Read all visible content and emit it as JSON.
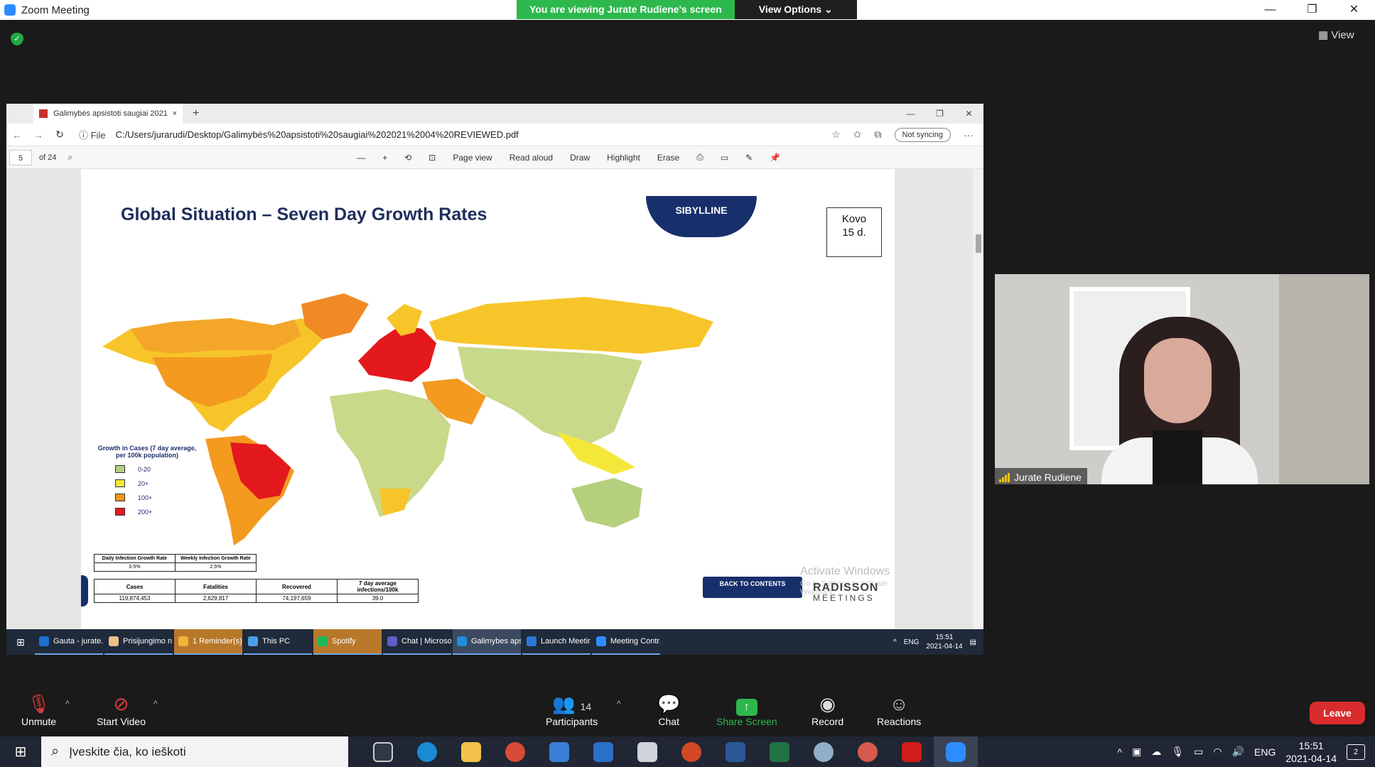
{
  "zoom": {
    "title": "Zoom Meeting",
    "viewing_banner": "You are viewing Jurate Rudiene's screen",
    "view_options": "View Options ⌄",
    "view_button": "View",
    "window_controls": [
      "—",
      "❐",
      "✕"
    ]
  },
  "edge": {
    "tab_title": "Galimybės apsistoti saugiai 2021",
    "tab_close": "×",
    "new_tab": "+",
    "file_label": "ⓘ  File",
    "url": "C:/Users/jurarudi/Desktop/Galimybės%20apsistoti%20saugiai%202021%2004%20REVIEWED.pdf",
    "sync_label": "Not syncing",
    "window_controls": [
      "—",
      "❐",
      "✕"
    ]
  },
  "pdf_toolbar": {
    "page_number": "5",
    "page_total": "of 24",
    "tools": [
      "—",
      "+",
      "⟲",
      "⊡",
      "Page view",
      "Read aloud",
      "Draw",
      "Highlight",
      "Erase"
    ]
  },
  "slide": {
    "title": "Global Situation – Seven Day Growth Rates",
    "logo_text": "SIBYLLINE",
    "note_line1": "Kovo",
    "note_line2": "15 d.",
    "legend_title": "Growth in Cases (7 day average, per 100k population)",
    "legend_items": [
      {
        "label": "0-20",
        "color": "#b5d07d"
      },
      {
        "label": "20+",
        "color": "#f5e73a"
      },
      {
        "label": "100+",
        "color": "#f39a1f"
      },
      {
        "label": "200+",
        "color": "#e3191d"
      }
    ],
    "growth_table": {
      "headers": [
        "Daily Infection Growth Rate",
        "Weekly Infection Growth Rate"
      ],
      "values": [
        "0.5%",
        "2.5%"
      ]
    },
    "totals_table": {
      "headers": [
        "Cases",
        "Fatalities",
        "Recovered",
        "7 day average infections/100k"
      ],
      "values": [
        "119,874,453",
        "2,629,817",
        "74,197,659",
        "39.0"
      ]
    },
    "back_button": "BACK TO CONTENTS",
    "brand_name": "RADISSON",
    "brand_sub": "MEETINGS",
    "activate_line1": "Activate Windows",
    "activate_line2": "Go to Settings to activate Windows.",
    "slide_no": "5"
  },
  "inner_taskbar": {
    "items": [
      {
        "label": "Gauta - jurate...",
        "color": "#1e6fd1"
      },
      {
        "label": "Prisijungimo n...",
        "color": "#e9c08a"
      },
      {
        "label": "1 Reminder(s)",
        "color": "#f3b43b"
      },
      {
        "label": "This PC",
        "color": "#4aa0e6"
      },
      {
        "label": "Spotify",
        "color": "#1db954"
      },
      {
        "label": "Chat | Microso...",
        "color": "#5b5fc7"
      },
      {
        "label": "Galimybes aps...",
        "color": "#1f8fd6"
      },
      {
        "label": "Launch Meetin...",
        "color": "#2b79d6"
      },
      {
        "label": "Meeting Contr...",
        "color": "#2d8cff"
      }
    ],
    "lang": "ENG",
    "time": "15:51",
    "date": "2021-04-14"
  },
  "participant": {
    "name": "Jurate Rudiene"
  },
  "bottom_bar": {
    "unmute": "Unmute",
    "start_video": "Start Video",
    "participants": "Participants",
    "participants_count": "14",
    "chat": "Chat",
    "share_screen": "Share Screen",
    "record": "Record",
    "reactions": "Reactions",
    "leave": "Leave"
  },
  "windows_taskbar": {
    "search_placeholder": "Įveskite čia, ko ieškoti",
    "apps": [
      {
        "name": "task-view",
        "color": "#2f3848"
      },
      {
        "name": "edge",
        "color": "#1a8ad4"
      },
      {
        "name": "file-explorer",
        "color": "#f2c24b"
      },
      {
        "name": "chrome",
        "color": "#d94a38"
      },
      {
        "name": "store",
        "color": "#3a7fd6"
      },
      {
        "name": "mail",
        "color": "#2a6fc9"
      },
      {
        "name": "app-n",
        "color": "#cfd3da"
      },
      {
        "name": "powerpoint",
        "color": "#d24726"
      },
      {
        "name": "word",
        "color": "#2b579a"
      },
      {
        "name": "excel",
        "color": "#217346"
      },
      {
        "name": "app-rocket",
        "color": "#8fb0c8"
      },
      {
        "name": "app-fox",
        "color": "#d55a4b"
      },
      {
        "name": "acrobat",
        "color": "#d21b1b"
      },
      {
        "name": "zoom",
        "color": "#2d8cff"
      }
    ],
    "lang": "ENG",
    "time": "15:51",
    "date": "2021-04-14",
    "notifications": "2"
  }
}
